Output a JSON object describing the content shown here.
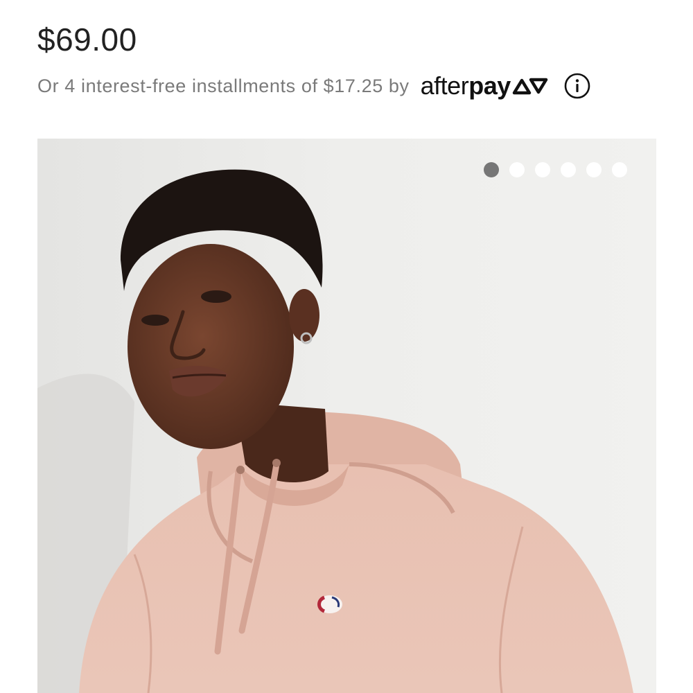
{
  "product": {
    "price": "$69.00",
    "installments_text": "Or 4 interest-free installments of $17.25 by",
    "afterpay_light": "after",
    "afterpay_bold": "pay",
    "info_icon": "info-circle-icon"
  },
  "gallery": {
    "image_count": 6,
    "active_index": 0,
    "dot_active_color": "#767676",
    "dot_inactive_color": "#ffffff",
    "hoodie_color": "#e9c0b0",
    "logo_icon": "champion-c-logo-icon"
  }
}
